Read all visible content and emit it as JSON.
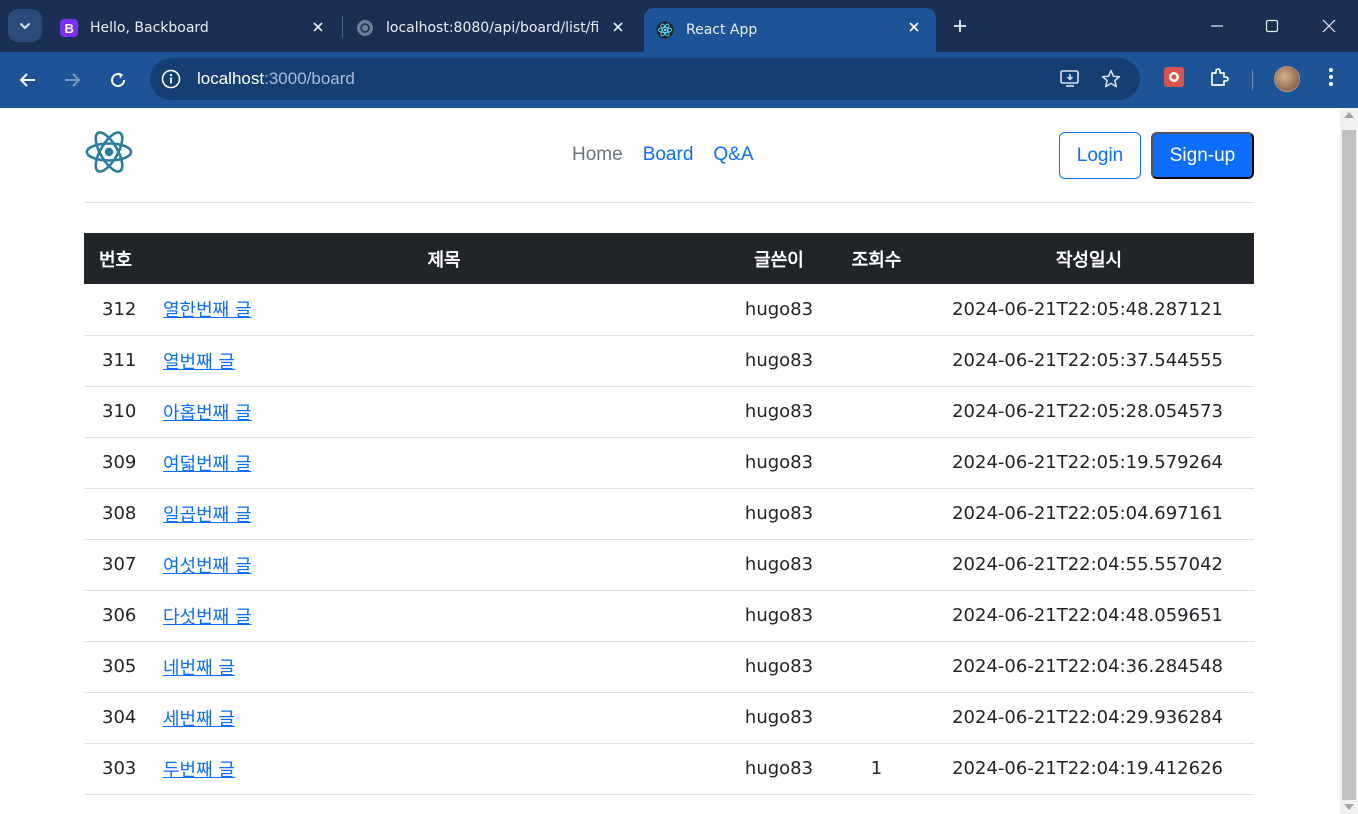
{
  "browser": {
    "tabs": [
      {
        "title": "Hello, Backboard",
        "favicon": "bootstrap-icon",
        "active": false
      },
      {
        "title": "localhost:8080/api/board/list/fi",
        "favicon": "globe-icon",
        "active": false
      },
      {
        "title": "React App",
        "favicon": "react-icon",
        "active": true
      }
    ],
    "address": {
      "host": "localhost",
      "path": ":3000/board"
    },
    "colors": {
      "tabstrip": "#1a2f52",
      "toolbar": "#1c5497",
      "omnibox": "#153f73"
    }
  },
  "header": {
    "nav": {
      "home": "Home",
      "board": "Board",
      "qna": "Q&A"
    },
    "login_label": "Login",
    "signup_label": "Sign-up"
  },
  "table": {
    "headers": {
      "no": "번호",
      "title": "제목",
      "writer": "글쓴이",
      "views": "조회수",
      "date": "작성일시"
    },
    "rows": [
      {
        "no": "312",
        "title": "열한번째 글",
        "writer": "hugo83",
        "views": "",
        "date": "2024-06-21T22:05:48.287121"
      },
      {
        "no": "311",
        "title": "열번째 글",
        "writer": "hugo83",
        "views": "",
        "date": "2024-06-21T22:05:37.544555"
      },
      {
        "no": "310",
        "title": "아홉번째 글",
        "writer": "hugo83",
        "views": "",
        "date": "2024-06-21T22:05:28.054573"
      },
      {
        "no": "309",
        "title": "여덟번째 글",
        "writer": "hugo83",
        "views": "",
        "date": "2024-06-21T22:05:19.579264"
      },
      {
        "no": "308",
        "title": "일곱번째 글",
        "writer": "hugo83",
        "views": "",
        "date": "2024-06-21T22:05:04.697161"
      },
      {
        "no": "307",
        "title": "여섯번째 글",
        "writer": "hugo83",
        "views": "",
        "date": "2024-06-21T22:04:55.557042"
      },
      {
        "no": "306",
        "title": "다섯번째 글",
        "writer": "hugo83",
        "views": "",
        "date": "2024-06-21T22:04:48.059651"
      },
      {
        "no": "305",
        "title": "네번째 글",
        "writer": "hugo83",
        "views": "",
        "date": "2024-06-21T22:04:36.284548"
      },
      {
        "no": "304",
        "title": "세번째 글",
        "writer": "hugo83",
        "views": "",
        "date": "2024-06-21T22:04:29.936284"
      },
      {
        "no": "303",
        "title": "두번째 글",
        "writer": "hugo83",
        "views": "1",
        "date": "2024-06-21T22:04:19.412626"
      }
    ]
  },
  "colors": {
    "primary": "#0d6efd",
    "dark": "#212529",
    "muted": "#6c757d",
    "border": "#dee2e6"
  }
}
